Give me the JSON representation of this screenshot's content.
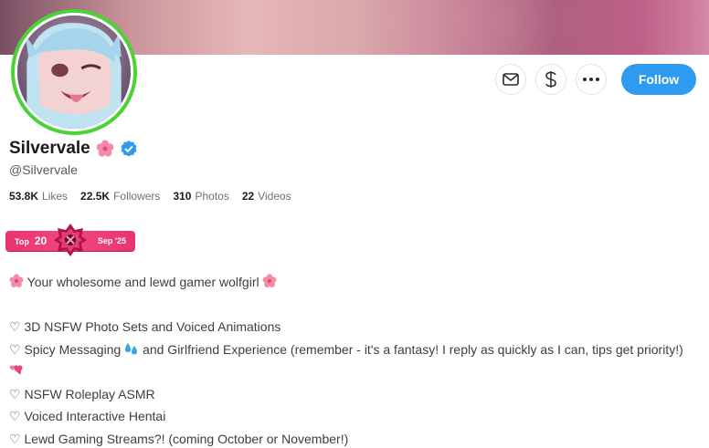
{
  "profile": {
    "display_name": "Silvervale",
    "handle": "@Silvervale",
    "name_emoji": "cherry-blossom-icon",
    "verified": true,
    "follow_label": "Follow"
  },
  "actions": {
    "message": "envelope-icon",
    "tip": "dollar-icon",
    "more": "more-icon"
  },
  "stats": [
    {
      "value": "53.8K",
      "label": "Likes"
    },
    {
      "value": "22.5K",
      "label": "Followers"
    },
    {
      "value": "310",
      "label": "Photos"
    },
    {
      "value": "22",
      "label": "Videos"
    }
  ],
  "rank_badge": {
    "top_label": "Top",
    "rank": "20",
    "date": "Sep '25"
  },
  "bio": {
    "tagline": "Your wholesome and lewd gamer wolfgirl",
    "lines": [
      "♡ 3D NSFW Photo Sets and Voiced Animations",
      "♡ Spicy Messaging",
      "and Girlfriend Experience (remember - it's a fantasy! I reply as quickly as I can, tips get priority!)",
      "♡ NSFW Roleplay ASMR",
      "♡ Voiced Interactive Hentai",
      "♡ Lewd Gaming Streams?! (coming October or November!)"
    ]
  },
  "colors": {
    "accent": "#2f9bf0",
    "avatar_ring": "#4cd137",
    "rank_badge": "#e9336f",
    "verified": "#2f9bf0"
  }
}
